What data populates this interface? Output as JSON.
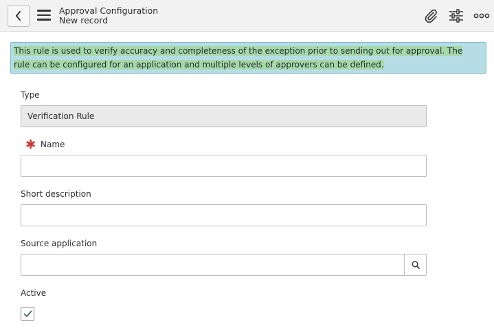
{
  "header": {
    "title": "Approval Configuration",
    "subtitle": "New record",
    "icons": {
      "back": "chevron-left-icon",
      "menu": "hamburger-icon",
      "attach": "paperclip-icon",
      "settings": "sliders-icon",
      "more": "more-dots-icon"
    }
  },
  "info": {
    "text": "This rule is used to verify accuracy and completeness of the exception prior to sending out for approval. The rule can be configured for an application and multiple levels of approvers can be defined."
  },
  "form": {
    "type": {
      "label": "Type",
      "value": "Verification Rule"
    },
    "name": {
      "label": "Name",
      "required_mark": "✱",
      "value": ""
    },
    "short_description": {
      "label": "Short description",
      "value": ""
    },
    "source_application": {
      "label": "Source application",
      "value": ""
    },
    "active": {
      "label": "Active",
      "checked": true
    }
  },
  "colors": {
    "banner_bg": "#b6dde6",
    "highlight": "#a6d8a8",
    "mandatory": "#c83c36",
    "check": "#3f6d5f"
  }
}
